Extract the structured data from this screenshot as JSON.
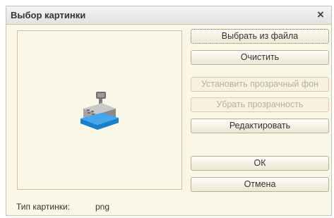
{
  "window": {
    "title": "Выбор картинки",
    "close_symbol": "×"
  },
  "preview": {
    "icon": "cash-register-icon"
  },
  "buttons": {
    "select_from_file": "Выбрать из файла",
    "clear": "Очистить",
    "set_transparent_bg": "Установить прозрачный фон",
    "remove_transparency": "Убрать прозрачность",
    "edit": "Редактировать",
    "ok": "ОК",
    "cancel": "Отмена"
  },
  "footer": {
    "type_label": "Тип картинки:",
    "type_value": "png"
  }
}
